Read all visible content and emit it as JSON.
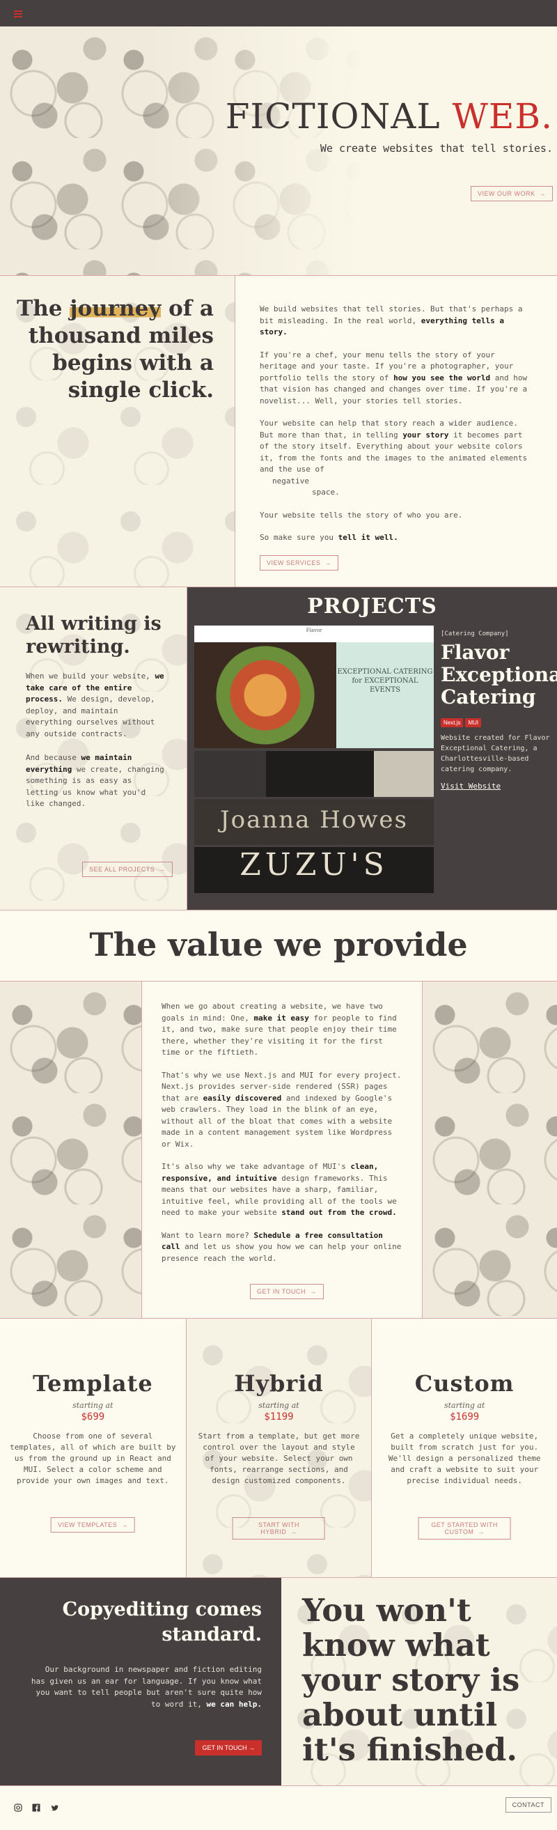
{
  "hero": {
    "title_main": "FICTIONAL ",
    "title_accent": "WEB.",
    "tagline": "We create websites that tell stories.",
    "cta": "VIEW OUR WORK"
  },
  "journey": {
    "heading_pre": "The ",
    "heading_highlight": "journey",
    "heading_post": " of a thousand miles begins with a single click.",
    "p1_a": "We build websites that tell stories. But that's perhaps a bit misleading. In the real world, ",
    "p1_b": "everything tells a story.",
    "p2_a": "If you're a chef, your menu tells the story of your heritage and your taste. If you're a photographer, your portfolio tells the story of ",
    "p2_b": "how you see the world",
    "p2_c": " and how that vision has changed and changes over time. If you're a novelist... Well, your stories tell stories.",
    "p3_a": "Your website can help that story reach a wider audience. But more than that, in telling ",
    "p3_b": "your story",
    "p3_c": " it becomes part of the story itself. Everything about your website colors it, from the fonts and the images to the animated elements and the use of",
    "neg": "negative",
    "space": "space.",
    "p4": "Your website tells the story of who you are.",
    "p5_a": "So make sure you ",
    "p5_b": "tell it well.",
    "cta": "VIEW SERVICES"
  },
  "writing": {
    "heading": "All writing is rewriting.",
    "p1_a": "When we build your website, ",
    "p1_b": "we take care of the entire process.",
    "p1_c": " We design, develop, deploy, and maintain everything ourselves without any outside contracts.",
    "p2_a": "And because ",
    "p2_b": "we maintain everything",
    "p2_c": " we create, changing something is as easy as letting us know what you'd like changed.",
    "cta": "SEE ALL PROJECTS"
  },
  "projects": {
    "heading": "PROJECTS",
    "shot_nav": "Flavor",
    "shot_text": "EXCEPTIONAL CATERING for EXCEPTIONAL EVENTS",
    "row3_text": "Joanna Howes",
    "row4_text": "ZUZU'S",
    "category": "[Catering Company]",
    "title": "Flavor Exceptional Catering",
    "badges": [
      "Next.js",
      "MUI"
    ],
    "description": "Website created for Flavor Exceptional Catering, a Charlottesville-based catering company.",
    "link": "Visit Website"
  },
  "value": {
    "heading": "The value we provide",
    "p1_a": "When we go about creating a website, we have two goals in mind: One, ",
    "p1_b": "make it easy",
    "p1_c": " for people to find it, and two, make sure that people enjoy their time there, whether they're visiting it for the first time or the fiftieth.",
    "p2_a": "That's why we use Next.js and MUI for every project. Next.js provides server-side rendered (SSR) pages that are ",
    "p2_b": "easily discovered",
    "p2_c": " and indexed by Google's web crawlers. They load in the blink of an eye, without all of the bloat that comes with a website made in a content management system like Wordpress or Wix.",
    "p3_a": "It's also why we take advantage of MUI's ",
    "p3_b": "clean, responsive, and intuitive",
    "p3_c": " design frameworks. This means that our websites have a sharp, familiar, intuitive feel, while providing all of the tools we need to make your website ",
    "p3_d": "stand out from the crowd.",
    "p4_a": "Want to learn more? ",
    "p4_b": "Schedule a free consultation call",
    "p4_c": " and let us show you how we can help your online presence reach the world.",
    "cta": "GET IN TOUCH"
  },
  "pricing": [
    {
      "name": "Template",
      "starting": "starting at",
      "price": "$699",
      "desc": "Choose from one of several templates, all of which are built by us from the ground up in React and MUI. Select a color scheme and provide your own images and text.",
      "cta": "VIEW TEMPLATES"
    },
    {
      "name": "Hybrid",
      "starting": "starting at",
      "price": "$1199",
      "desc": "Start from a template, but get more control over the layout and style of your website. Select your own fonts, rearrange sections, and design customized components.",
      "cta": "START WITH HYBRID"
    },
    {
      "name": "Custom",
      "starting": "starting at",
      "price": "$1699",
      "desc": "Get a completely unique website, built from scratch just for you. We'll design a personalized theme and craft a website to suit your precise individual needs.",
      "cta": "GET STARTED WITH CUSTOM"
    }
  ],
  "copyediting": {
    "heading": "Copyediting comes standard.",
    "p_a": "Our background in newspaper and fiction editing has given us an ear for language. If you know what you want to tell people but aren't sure quite how to word it, ",
    "p_b": "we can help.",
    "cta": "GET IN TOUCH",
    "big_quote": "You won't know what your story is about until it's finished."
  },
  "footer": {
    "contact": "CONTACT",
    "icons": [
      "instagram-icon",
      "facebook-icon",
      "twitter-icon"
    ]
  },
  "colors": {
    "accent_red": "#c9302c",
    "dark": "#464040",
    "cream": "#fdfbef",
    "highlight": "#e0b35a"
  }
}
